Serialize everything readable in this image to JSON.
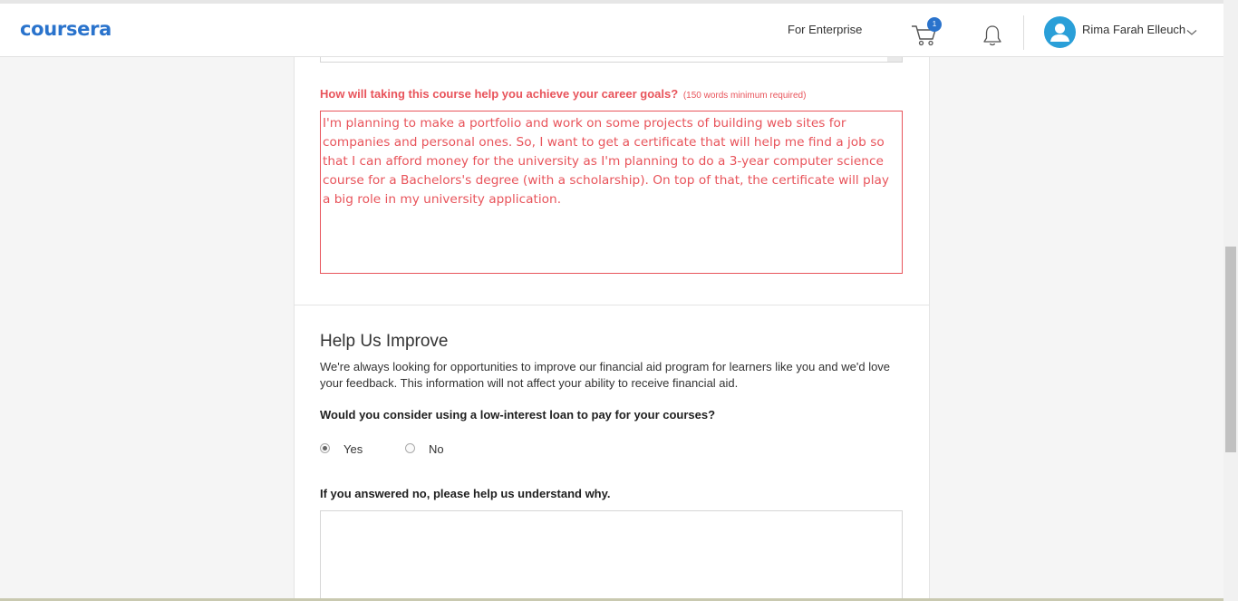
{
  "header": {
    "logo": "coursera",
    "for_enterprise": "For Enterprise",
    "cart_count": "1",
    "user_name": "Rima Farah Elleuch"
  },
  "career_question": {
    "label": "How will taking this course help you achieve your career goals?",
    "hint": "(150 words minimum required)",
    "answer": "I'm planning to make a portfolio and work on some projects of building web sites for companies and personal ones. So, I want to get a certificate that will help me find a job so that I can afford money for the university as I'm planning to do a 3-year computer science course for a Bachelors's degree (with a scholarship). On top of that, the certificate will play a big role in my university application."
  },
  "help_improve": {
    "title": "Help Us Improve",
    "description": "We're always looking for opportunities to improve our financial aid program for learners like you and we'd love your feedback. This information will not affect your ability to receive financial aid.",
    "loan_question": "Would you consider using a low-interest loan to pay for your courses?",
    "options": [
      "Yes",
      "No"
    ],
    "selected": "Yes",
    "why_question": "If you answered no, please help us understand why.",
    "why_answer": ""
  },
  "colors": {
    "brand": "#2a73cc",
    "error": "#e8545b",
    "avatar": "#2a9fd8"
  }
}
